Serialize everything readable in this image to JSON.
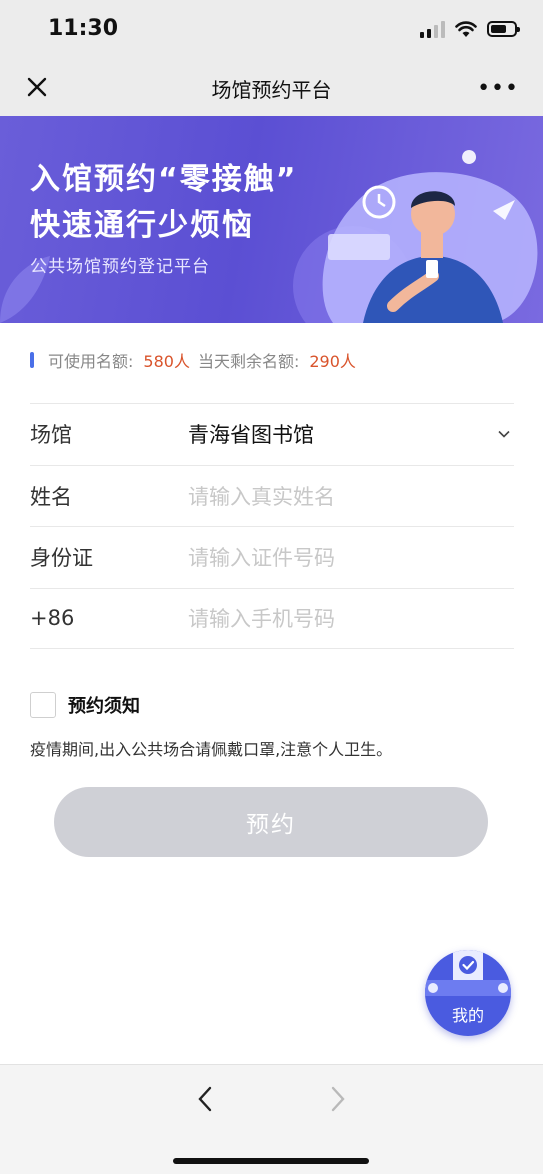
{
  "status_bar": {
    "time": "11:30"
  },
  "nav": {
    "title": "场馆预约平台",
    "close_icon": "close-icon",
    "more_icon": "more-icon"
  },
  "banner": {
    "line1": "入馆预约“零接触”",
    "line2": "快速通行少烦恼",
    "subtitle": "公共场馆预约登记平台"
  },
  "quota": {
    "available_label": "可使用名额:",
    "available_value": "580人",
    "remaining_label": "当天剩余名额:",
    "remaining_value": "290人"
  },
  "form": {
    "venue_label": "场馆",
    "venue_value": "青海省图书馆",
    "name_label": "姓名",
    "name_placeholder": "请输入真实姓名",
    "id_label": "身份证",
    "id_placeholder": "请输入证件号码",
    "phone_label": "+86",
    "phone_placeholder": "请输入手机号码"
  },
  "notice": {
    "title": "预约须知",
    "text": "疫情期间,出入公共场合请佩戴口罩,注意个人卫生。",
    "checked": false
  },
  "submit_label": "预约",
  "fab_label": "我的",
  "colors": {
    "accent": "#4a6fe8",
    "quota_value": "#d9542c",
    "banner": "#5b4fd3",
    "button_disabled": "#cfd0d6"
  }
}
